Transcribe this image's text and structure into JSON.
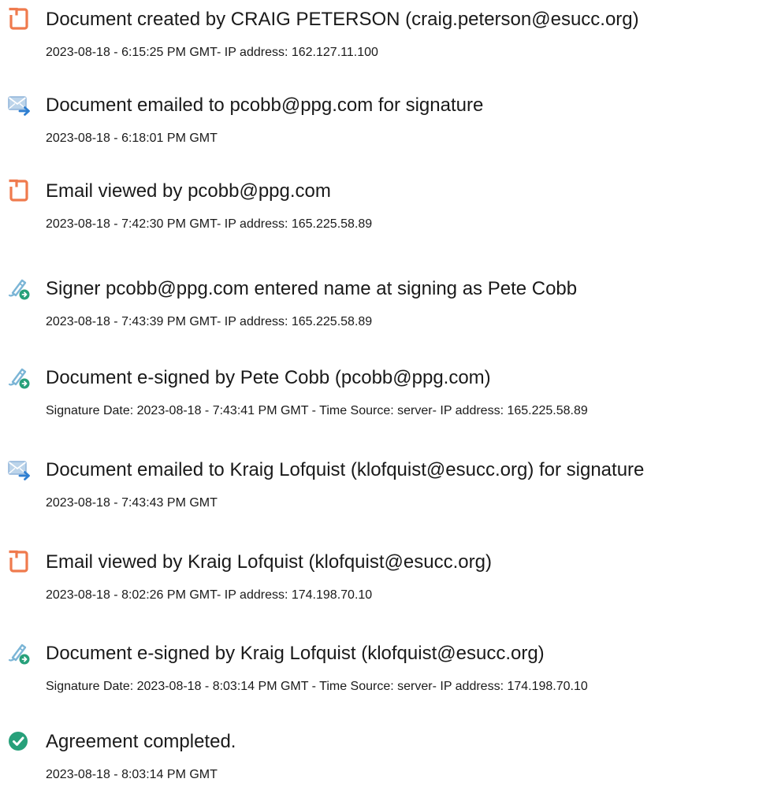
{
  "colors": {
    "doc_icon": "#ef7a4d",
    "email_icon_body": "#bcd4ea",
    "email_icon_arrow": "#2f7fd1",
    "pen_icon": "#7bb5d6",
    "badge_icon": "#27a07a",
    "complete_icon": "#27a07a"
  },
  "events": [
    {
      "icon": "document-icon",
      "title": "Document created by CRAIG PETERSON (craig.peterson@esucc.org)",
      "detail": "2023-08-18 - 6:15:25 PM GMT- IP address: 162.127.11.100"
    },
    {
      "icon": "email-icon",
      "title": "Document emailed to pcobb@ppg.com for signature",
      "detail": "2023-08-18 - 6:18:01 PM GMT"
    },
    {
      "icon": "document-icon",
      "title": "Email viewed by pcobb@ppg.com",
      "detail": "2023-08-18 - 7:42:30 PM GMT- IP address: 165.225.58.89"
    },
    {
      "icon": "signature-pen-icon",
      "title": "Signer pcobb@ppg.com entered name at signing as Pete Cobb",
      "detail": "2023-08-18 - 7:43:39 PM GMT- IP address: 165.225.58.89"
    },
    {
      "icon": "signature-pen-icon",
      "title": "Document e-signed by Pete Cobb (pcobb@ppg.com)",
      "detail": "Signature Date: 2023-08-18 - 7:43:41 PM GMT - Time Source: server- IP address: 165.225.58.89"
    },
    {
      "icon": "email-icon",
      "title": "Document emailed to Kraig Lofquist (klofquist@esucc.org) for signature",
      "detail": "2023-08-18 - 7:43:43 PM GMT"
    },
    {
      "icon": "document-icon",
      "title": "Email viewed by Kraig Lofquist (klofquist@esucc.org)",
      "detail": "2023-08-18 - 8:02:26 PM GMT- IP address: 174.198.70.10"
    },
    {
      "icon": "signature-pen-icon",
      "title": "Document e-signed by Kraig Lofquist (klofquist@esucc.org)",
      "detail": "Signature Date: 2023-08-18 - 8:03:14 PM GMT - Time Source: server- IP address: 174.198.70.10"
    },
    {
      "icon": "check-circle-icon",
      "title": "Agreement completed.",
      "detail": "2023-08-18 - 8:03:14 PM GMT"
    }
  ]
}
